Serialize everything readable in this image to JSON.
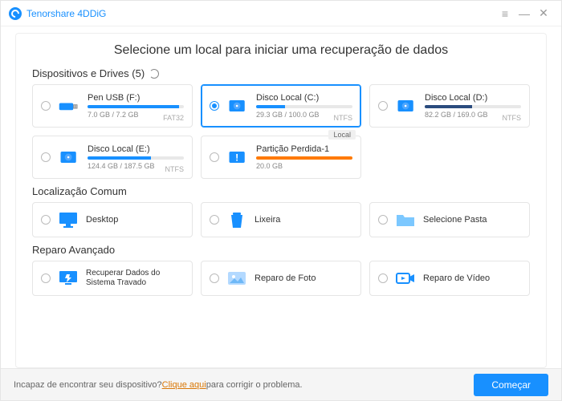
{
  "app": {
    "title": "Tenorshare 4DDiG"
  },
  "page": {
    "title": "Selecione um local para iniciar uma recuperação de dados"
  },
  "sections": {
    "devices": "Dispositivos e Drives (5)",
    "common": "Localização Comum",
    "advanced": "Reparo Avançado"
  },
  "drives": [
    {
      "name": "Pen USB (F:)",
      "size": "7.0 GB / 7.2 GB",
      "fs": "FAT32",
      "pct": 95,
      "color": "blue"
    },
    {
      "name": "Disco Local (C:)",
      "size": "29.3 GB / 100.0 GB",
      "fs": "NTFS",
      "pct": 30,
      "color": "blue",
      "selected": true
    },
    {
      "name": "Disco Local (D:)",
      "size": "82.2 GB / 169.0 GB",
      "fs": "NTFS",
      "pct": 49,
      "color": "navy"
    },
    {
      "name": "Disco Local (E:)",
      "size": "124.4 GB / 187.5 GB",
      "fs": "NTFS",
      "pct": 66,
      "color": "blue"
    },
    {
      "name": "Partição Perdida-1",
      "size": "20.0 GB",
      "fs": "",
      "pct": 100,
      "color": "orange",
      "badge": "Local"
    }
  ],
  "common": [
    {
      "label": "Desktop"
    },
    {
      "label": "Lixeira"
    },
    {
      "label": "Selecione Pasta"
    }
  ],
  "advanced": [
    {
      "label": "Recuperar Dados do Sistema Travado"
    },
    {
      "label": "Reparo de Foto"
    },
    {
      "label": "Reparo de Vídeo"
    }
  ],
  "footer": {
    "prefix": "Incapaz de encontrar seu dispositivo? ",
    "link": "Clique aqui",
    "suffix": " para corrigir o problema.",
    "start": "Começar"
  }
}
